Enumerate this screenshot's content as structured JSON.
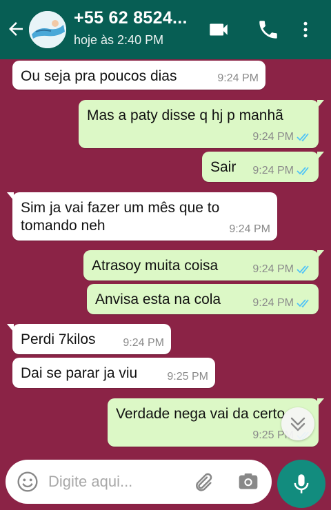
{
  "header": {
    "contact_name": "+55 62 8524...",
    "last_seen": "hoje às 2:40 PM",
    "back_icon": "arrow-left-icon",
    "video_icon": "video-call-icon",
    "call_icon": "phone-icon",
    "menu_icon": "more-vert-icon"
  },
  "messages": [
    {
      "text": "Ou seja  pra poucos dias",
      "time": "9:24 PM",
      "direction": "in"
    },
    {
      "text": "Mas a paty disse q hj p manhã",
      "time": "9:24 PM",
      "direction": "out",
      "status": "read"
    },
    {
      "text": "Sair",
      "time": "9:24 PM",
      "direction": "out",
      "status": "read"
    },
    {
      "text": "Sim ja vai fazer um mês  que to\ntomando neh",
      "line1": "Sim ja vai fazer um mês  que to",
      "line2": "tomando neh",
      "time": "9:24 PM",
      "direction": "in"
    },
    {
      "text": "Atrasoy muita coisa",
      "time": "9:24 PM",
      "direction": "out",
      "status": "read"
    },
    {
      "text": "Anvisa esta na cola",
      "time": "9:24 PM",
      "direction": "out",
      "status": "read"
    },
    {
      "text": "Perdi 7kilos",
      "time": "9:24 PM",
      "direction": "in"
    },
    {
      "text": "Dai se parar ja viu",
      "time": "9:25 PM",
      "direction": "in"
    },
    {
      "text": "Verdade nega vai da certo",
      "time": "9:25 PM",
      "direction": "out",
      "status": "read"
    }
  ],
  "composer": {
    "placeholder": "Digite aqui...",
    "emoji_icon": "emoji-icon",
    "attach_icon": "paperclip-icon",
    "camera_icon": "camera-icon",
    "mic_icon": "microphone-icon"
  },
  "scroll_button_icon": "double-chevron-down-icon",
  "colors": {
    "header": "#075e54",
    "chat_background": "#8b2346",
    "outgoing_bubble": "#dcf8c6",
    "incoming_bubble": "#ffffff",
    "read_ticks": "#4fc3f7",
    "mic_button": "#128c7e"
  }
}
